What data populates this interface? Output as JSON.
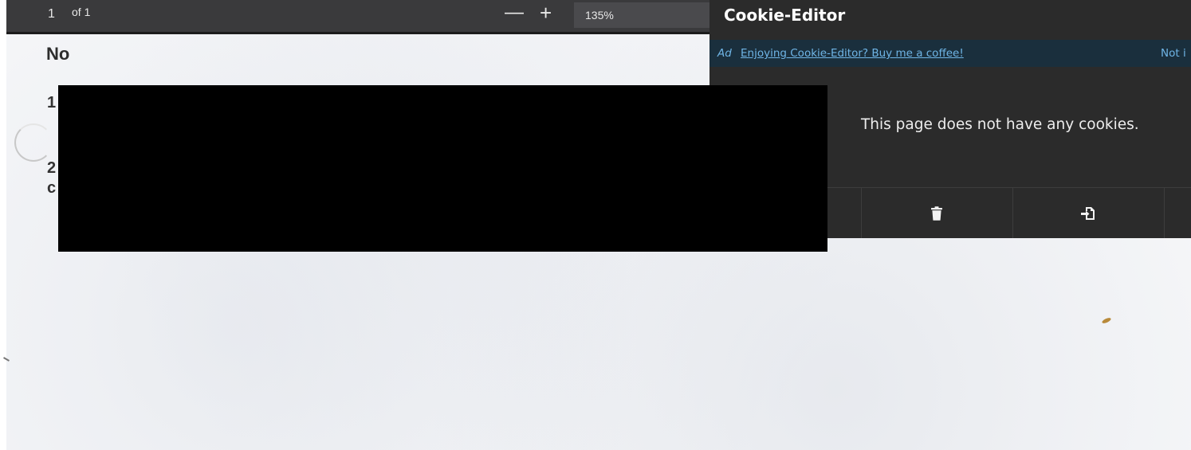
{
  "pdf_toolbar": {
    "page_number": "1",
    "page_total": "of 1",
    "zoom_out_glyph": "—",
    "zoom_in_glyph": "+",
    "zoom_level": "135%"
  },
  "document": {
    "heading": "No",
    "item_1": "1",
    "item_2": "2",
    "item_2_cont": "c"
  },
  "cookie_editor": {
    "title": "Cookie-Editor",
    "ad_label": "Ad",
    "ad_link": "Enjoying Cookie-Editor? Buy me a coffee!",
    "ad_dismiss": "Not i",
    "empty_message": "This page does not have any cookies.",
    "actions": [
      {
        "name": "delete-all",
        "icon": "trash-icon"
      },
      {
        "name": "import",
        "icon": "import-icon"
      }
    ]
  },
  "colors": {
    "popup_bg": "#2b2b2b",
    "ad_bg": "#1a2f3d",
    "link": "#6fb5e6",
    "toolbar_bg": "#3a3a3c"
  }
}
